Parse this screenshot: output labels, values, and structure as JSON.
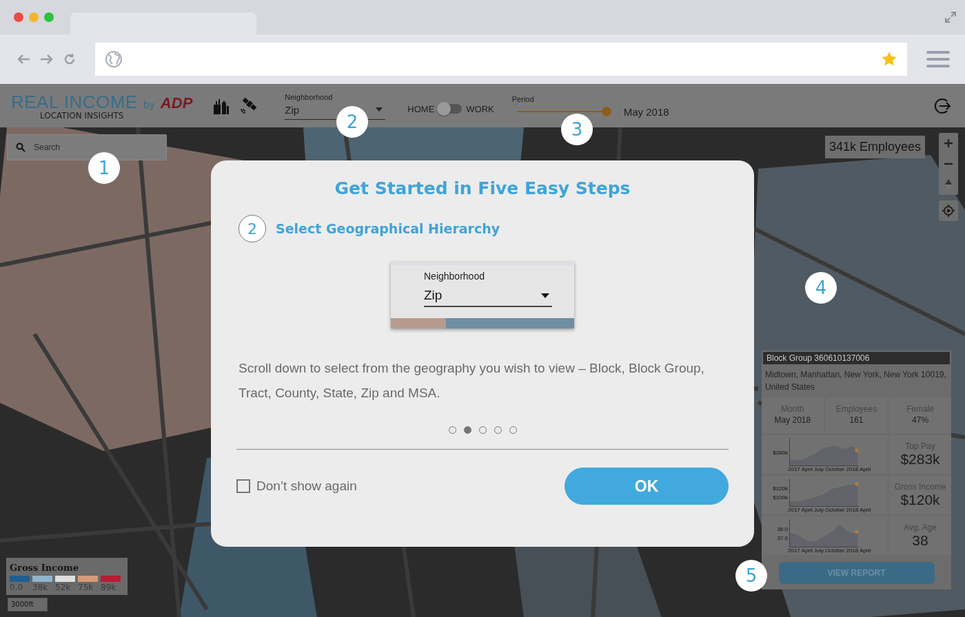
{
  "header": {
    "logo": {
      "title": "REAL INCOME",
      "by": "by",
      "brand": "ADP",
      "subtitle": "LOCATION INSIGHTS"
    },
    "geography": {
      "label": "Neighborhood",
      "value": "Zip"
    },
    "toggle": {
      "left": "HOME",
      "right": "WORK",
      "on": false
    },
    "period": {
      "label": "Period",
      "level": 1,
      "value": "May 2018"
    }
  },
  "map": {
    "search": {
      "placeholder": "Search"
    },
    "employees": "341k Employees",
    "legend": {
      "title": "Gross Income",
      "items": [
        {
          "color": "#1f5f8f",
          "label": "0.0"
        },
        {
          "color": "#8fb4cc",
          "label": "38k"
        },
        {
          "color": "#dedede",
          "label": "52k"
        },
        {
          "color": "#d59a78",
          "label": "75k"
        },
        {
          "color": "#b81c32",
          "label": "89k"
        }
      ]
    },
    "scale": "3000ft"
  },
  "markers": [
    "1",
    "2",
    "3",
    "4",
    "5"
  ],
  "panel": {
    "title": "Block Group 360610137006",
    "address": "Midtown, Manhattan, New York, New York 10019, United States",
    "stats": [
      {
        "label": "Month",
        "value": "May 2018"
      },
      {
        "label": "Employees",
        "value": "161"
      },
      {
        "label": "Female",
        "value": "47%"
      }
    ],
    "metrics": [
      {
        "label": "Top Pay",
        "value": "$283k",
        "y_labels": [
          "$280k"
        ],
        "x_labels": [
          "2017",
          "April",
          "July",
          "October",
          "2018",
          "April"
        ]
      },
      {
        "label": "Gross Income",
        "value": "$120k",
        "y_labels": [
          "$120k",
          "$100k"
        ],
        "x_labels": [
          "2017",
          "April",
          "July",
          "October",
          "2018",
          "April"
        ]
      },
      {
        "label": "Avg. Age",
        "value": "38",
        "y_labels": [
          "38.0",
          "37.0"
        ],
        "x_labels": [
          "2017",
          "April",
          "July",
          "October",
          "2018",
          "April"
        ]
      }
    ],
    "button": "VIEW REPORT"
  },
  "modal": {
    "title": "Get Started in Five Easy Steps",
    "step": {
      "number": "2",
      "title": "Select Geographical Hierarchy"
    },
    "preview": {
      "label": "Neighborhood",
      "value": "Zip"
    },
    "text": "Scroll down to select from the geography you wish to view – Block, Block Group, Tract, County, State, Zip and MSA.",
    "dots": [
      {
        "selected": false
      },
      {
        "selected": true
      },
      {
        "selected": false
      },
      {
        "selected": false
      },
      {
        "selected": false
      }
    ],
    "checkbox": {
      "label": "Don’t show again",
      "checked": false
    },
    "button": "OK"
  }
}
